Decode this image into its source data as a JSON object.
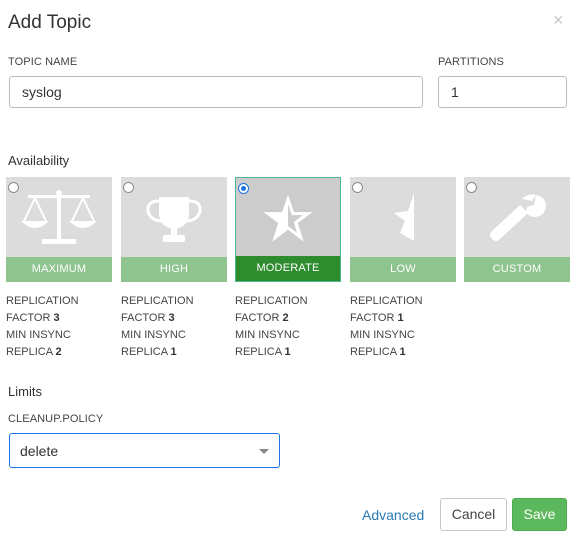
{
  "dialog": {
    "title": "Add Topic",
    "close_glyph": "×"
  },
  "fields": {
    "topic_name": {
      "label": "TOPIC NAME",
      "value": "syslog"
    },
    "partitions": {
      "label": "PARTITIONS",
      "value": "1"
    }
  },
  "availability": {
    "heading": "Availability",
    "selected": "MODERATE",
    "options": [
      {
        "label": "MAXIMUM",
        "icon": "scale-icon",
        "lines": [
          {
            "text": "REPLICATION"
          },
          {
            "text": "FACTOR ",
            "bold": "3"
          },
          {
            "text": "MIN INSYNC"
          },
          {
            "text": "REPLICA ",
            "bold": "2"
          }
        ]
      },
      {
        "label": "HIGH",
        "icon": "trophy-icon",
        "lines": [
          {
            "text": "REPLICATION"
          },
          {
            "text": "FACTOR ",
            "bold": "3"
          },
          {
            "text": "MIN INSYNC"
          },
          {
            "text": "REPLICA ",
            "bold": "1"
          }
        ]
      },
      {
        "label": "MODERATE",
        "icon": "half-star-icon",
        "lines": [
          {
            "text": "REPLICATION"
          },
          {
            "text": "FACTOR ",
            "bold": "2"
          },
          {
            "text": "MIN INSYNC"
          },
          {
            "text": "REPLICA ",
            "bold": "1"
          }
        ]
      },
      {
        "label": "LOW",
        "icon": "quarter-star-icon",
        "lines": [
          {
            "text": "REPLICATION"
          },
          {
            "text": "FACTOR ",
            "bold": "1"
          },
          {
            "text": "MIN INSYNC"
          },
          {
            "text": "REPLICA ",
            "bold": "1"
          }
        ]
      },
      {
        "label": "CUSTOM",
        "icon": "wrench-icon",
        "lines": []
      }
    ]
  },
  "limits": {
    "heading": "Limits",
    "cleanup_policy": {
      "label": "CLEANUP.POLICY",
      "value": "delete"
    }
  },
  "footer": {
    "advanced_label": "Advanced",
    "cancel_label": "Cancel",
    "save_label": "Save"
  },
  "colors": {
    "accent": "#5cb85c",
    "selected_bar": "#2e8b2e",
    "bar": "#8fc48f",
    "link": "#2a7bb5",
    "focus": "#1a73e8"
  }
}
